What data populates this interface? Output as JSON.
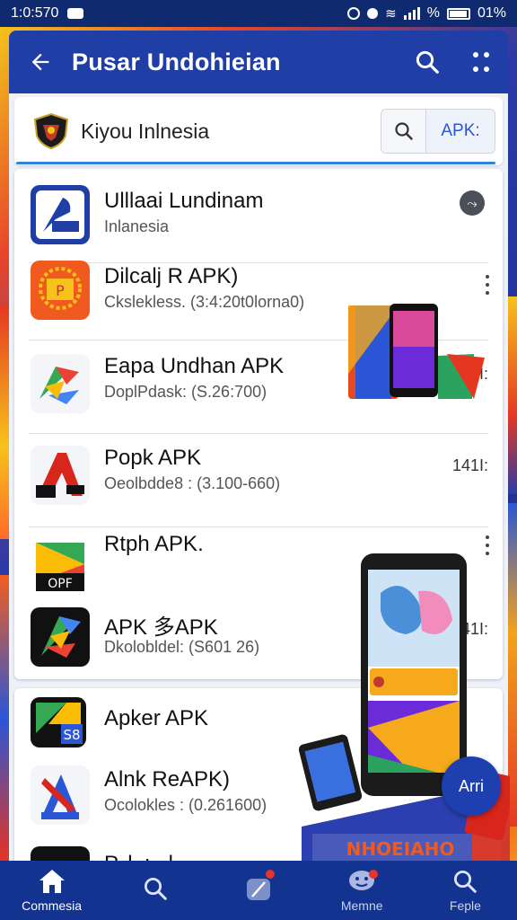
{
  "status_bar": {
    "time": "1:0:570",
    "battery_text": "01%",
    "percent_symbol": "%"
  },
  "app_bar": {
    "title": "Pusar Undohieian",
    "back_icon": "arrow-left-icon",
    "search_icon": "search-icon",
    "menu_icon": "more-vert-icon"
  },
  "search": {
    "site_name": "Kiyou Inlnesia",
    "apk_button": "APK:"
  },
  "apps": [
    {
      "name": "Ulllaai Lundinam",
      "meta": "Inlanesia",
      "action": ""
    },
    {
      "name": "Dilcalj R APK)",
      "meta": "Ckslekless. (3:4:20t0lorna0)",
      "action": ""
    },
    {
      "name": "Eapa Undhan APK",
      "meta": "DoplPdask: (S.26:700)",
      "action": "041I:"
    },
    {
      "name": "Popk APK",
      "meta": "Oeolbdde8 : (3.100-660)",
      "action": "141I:"
    },
    {
      "name": "Rtph APK.",
      "meta": "",
      "action": ""
    },
    {
      "name": "APK 多APK",
      "meta": "Dkolobldel: (S601 26)",
      "action": "041I:"
    }
  ],
  "apps2": [
    {
      "name": "Apker APK",
      "meta": ""
    },
    {
      "name": "Alnk ReAPK)",
      "meta": "Ocolokles : (0.261600)"
    },
    {
      "name": "P..l..: ..l...",
      "meta": ""
    }
  ],
  "promo": {
    "banner_text": "NHOEIAHO",
    "apk_bubble": "Arri"
  },
  "bottom_nav": [
    {
      "label": "Commesia",
      "icon": "home-icon"
    },
    {
      "label": "",
      "icon": "search-icon"
    },
    {
      "label": "",
      "icon": "feather-icon"
    },
    {
      "label": "Memne",
      "icon": "chat-face-icon"
    },
    {
      "label": "Feple",
      "icon": "search-icon"
    }
  ],
  "colors": {
    "app_bar": "#1f3ea6",
    "status_bar": "#0f2a6e",
    "bottom_nav": "#12338f",
    "accent": "#2f86d8"
  }
}
